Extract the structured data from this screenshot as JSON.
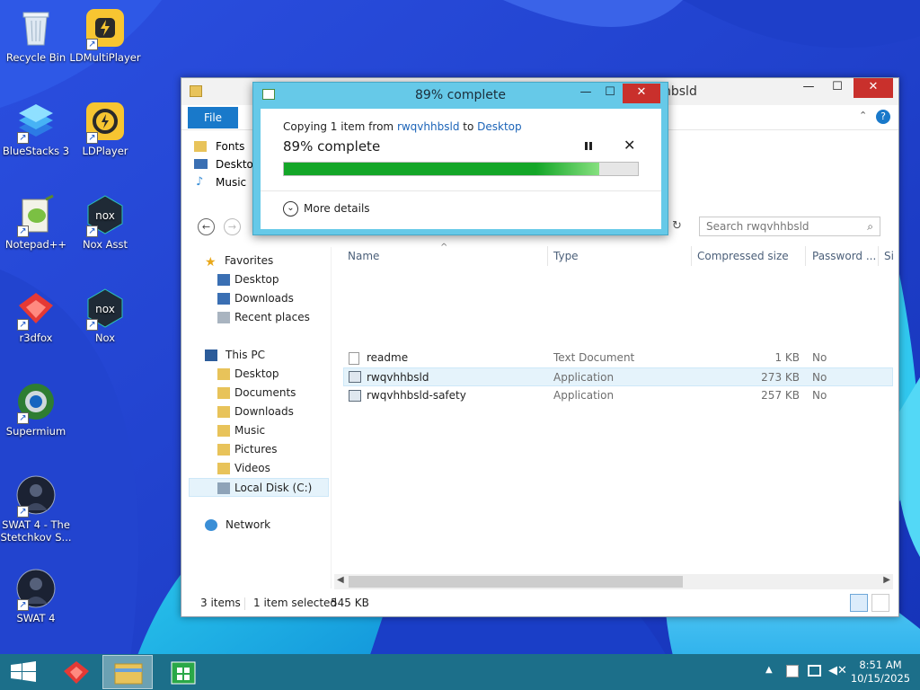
{
  "desktop": {
    "icons": [
      {
        "label": "Recycle Bin"
      },
      {
        "label": "LDMultiPlayer"
      },
      {
        "label": "BlueStacks 3"
      },
      {
        "label": "LDPlayer"
      },
      {
        "label": "Notepad++"
      },
      {
        "label": "Nox Asst"
      },
      {
        "label": "r3dfox"
      },
      {
        "label": "Nox"
      },
      {
        "label": "Supermium"
      },
      {
        "label": "SWAT 4 - The Stetchkov S..."
      },
      {
        "label": "SWAT 4"
      }
    ]
  },
  "explorer": {
    "title_fragment": "hbsld",
    "file_tab": "File",
    "ribbon_items": [
      "Fonts",
      "Desktop",
      "Music"
    ],
    "search_placeholder": "Search rwqvhhbsld",
    "nav": {
      "favorites": "Favorites",
      "fav_items": [
        "Desktop",
        "Downloads",
        "Recent places"
      ],
      "this_pc": "This PC",
      "pc_items": [
        "Desktop",
        "Documents",
        "Downloads",
        "Music",
        "Pictures",
        "Videos",
        "Local Disk (C:)"
      ],
      "network": "Network"
    },
    "columns": {
      "name": "Name",
      "type": "Type",
      "compressed": "Compressed size",
      "password": "Password ...",
      "size": "Si"
    },
    "files": [
      {
        "name": "readme",
        "type": "Text Document",
        "size": "1 KB",
        "password": "No"
      },
      {
        "name": "rwqvhhbsld",
        "type": "Application",
        "size": "273 KB",
        "password": "No"
      },
      {
        "name": "rwqvhhbsld-safety",
        "type": "Application",
        "size": "257 KB",
        "password": "No"
      }
    ],
    "status": {
      "items": "3 items",
      "selected": "1 item selected",
      "selected_size": "545 KB"
    }
  },
  "copy_dialog": {
    "title": "89% complete",
    "sub_prefix": "Copying 1 item from ",
    "source": "rwqvhhbsld",
    "sub_mid": " to ",
    "dest": "Desktop",
    "percent_text": "89% complete",
    "progress": 0.89,
    "more_details": "More details"
  },
  "taskbar": {
    "time": "8:51 AM",
    "date": "10/15/2025"
  },
  "colors": {
    "accent": "#1979ca",
    "progress": "#14a628",
    "dialog_frame": "#66c9e8",
    "taskbar": "#1c6f8a"
  }
}
